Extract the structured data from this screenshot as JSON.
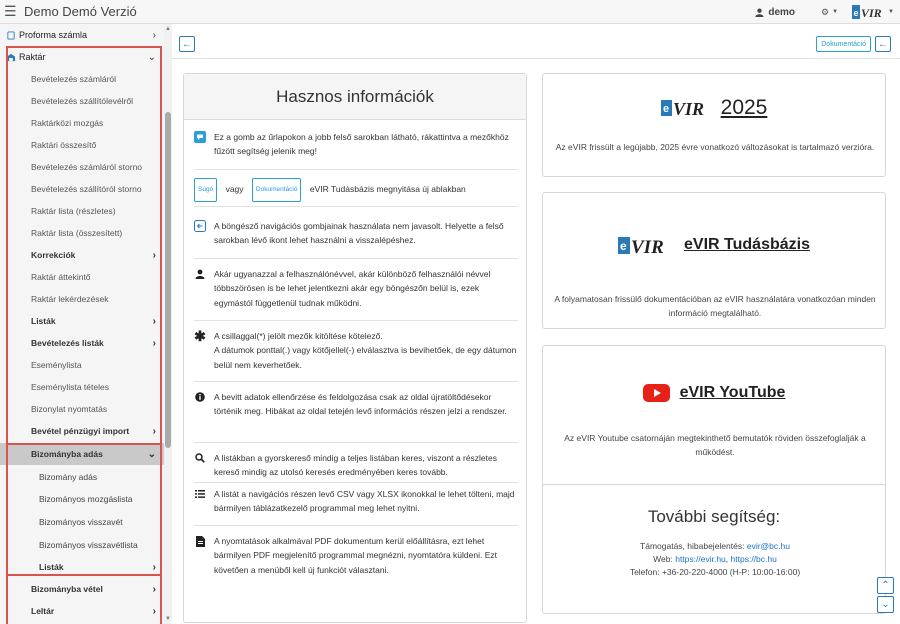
{
  "app": {
    "title": "Demo Demó Verzió"
  },
  "topbar": {
    "user": "demo",
    "logo_text": "VIR"
  },
  "sidebar": {
    "items": [
      {
        "label": "Proforma számla"
      },
      {
        "label": "Raktár"
      },
      {
        "label": "Bevételezés számláról"
      },
      {
        "label": "Bevételezés szállítólevélről"
      },
      {
        "label": "Raktárközi mozgás"
      },
      {
        "label": "Raktári összesítő"
      },
      {
        "label": "Bevételezés számláról storno"
      },
      {
        "label": "Bevételezés szállítóról storno"
      },
      {
        "label": "Raktár lista (részletes)"
      },
      {
        "label": "Raktár lista (összesített)"
      },
      {
        "label": "Korrekciók"
      },
      {
        "label": "Raktár áttekintő"
      },
      {
        "label": "Raktár lekérdezések"
      },
      {
        "label": "Listák"
      },
      {
        "label": "Bevételezés listák"
      },
      {
        "label": "Eseménylista"
      },
      {
        "label": "Eseménylista tételes"
      },
      {
        "label": "Bizonylat nyomtatás"
      },
      {
        "label": "Bevétel pénzügyi import"
      },
      {
        "label": "Bizományba adás"
      },
      {
        "label": "Bizomány adás"
      },
      {
        "label": "Bizományos mozgáslista"
      },
      {
        "label": "Bizományos visszavét"
      },
      {
        "label": "Bizományos visszavétlista"
      },
      {
        "label": "Listák"
      },
      {
        "label": "Bizományba vétel"
      },
      {
        "label": "Leltár"
      }
    ]
  },
  "header": {
    "doc_button": "Dokumentáció"
  },
  "info": {
    "title": "Hasznos információk",
    "items": [
      {
        "text": "Ez a gomb az űrlapokon a jobb felső sarokban látható, rákattintva a mezőkhöz fűzött segítség jelenik meg!"
      },
      {
        "sugo": "Súgó",
        "vagy": "vagy",
        "doc": "Dokumentáció",
        "text": "eVIR Tudásbázis megnyitása új ablakban"
      },
      {
        "text": "A böngésző navigációs gombjainak használata nem javasolt. Helyette a felső sarokban lévő ikont lehet használni a visszalépéshez."
      },
      {
        "text": "Akár ugyanazzal a felhasználónévvel, akár különböző felhasználói névvel többszörösen is be lehet jelentkezni akár egy böngészőn belül is, ezek egymástól függetlenül tudnak működni."
      },
      {
        "text1": "A csillaggal(*) jelölt mezők kitöltése kötelező.",
        "text2": "A dátumok ponttal(.) vagy kötőjellel(-) elválasztva is bevihetőek, de egy dátumon belül nem keverhetőek."
      },
      {
        "text": "A bevitt adatok ellenőrzése és feldolgozása csak az oldal újratöltődésekor történik meg. Hibákat az oldal tetején levő információs részen jelzi a rendszer."
      },
      {
        "text": "A listákban a gyorskereső mindig a teljes listában keres, viszont a részletes kereső mindig az utolsó keresés eredményében keres tovább."
      },
      {
        "text": "A listát a navigációs részen levő CSV vagy XLSX ikonokkal le lehet tölteni, majd bármilyen táblázatkezelő programmal meg lehet nyitni."
      },
      {
        "text": "A nyomtatások alkalmával PDF dokumentum kerül előállításra, ezt lehet bármilyen PDF megjelenítő programmal megnézni, nyomtatóra küldeni. Ezt követően a menüből kell új funkciót választani."
      }
    ]
  },
  "cards": [
    {
      "title": "2025",
      "text": "Az eVIR frissült a legújabb, 2025 évre vonatkozó változásokat is tartalmazó verzióra."
    },
    {
      "title": "eVIR Tudásbázis",
      "text": "A folyamatosan frissülő dokumentációban az eVIR használatára vonatkozóan minden információ megtalálható."
    },
    {
      "title": "eVIR YouTube",
      "text": "Az eVIR Youtube csatornáján megtekinthető bemutatók röviden összefoglalják a működést."
    }
  ],
  "help": {
    "title": "További segítség:",
    "support_label": "Támogatás, hibabejelentés:",
    "support_email": "evir@bc.hu",
    "web_label": "Web:",
    "web1": "https://evir.hu",
    "web_sep": ",",
    "web2": "https://bc.hu",
    "phone": "Telefon: +36-20-220-4000 (H-P: 10:00-16:00)"
  },
  "colors": {
    "accent": "#2a7ab8",
    "highlight": "#d9534f",
    "youtube": "#e62117"
  }
}
